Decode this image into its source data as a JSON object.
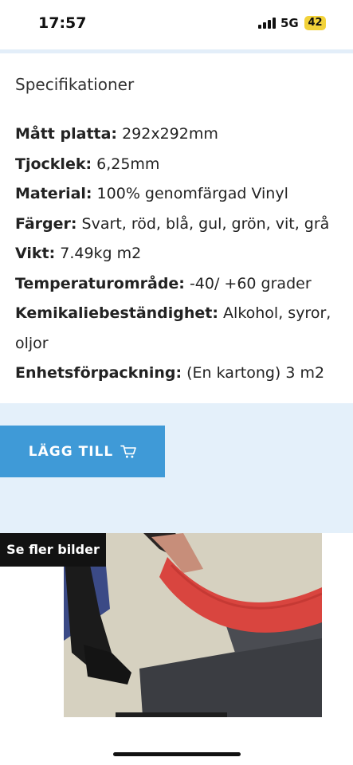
{
  "status_bar": {
    "time": "17:57",
    "network": "5G",
    "battery": "42"
  },
  "specs": {
    "heading": "Specifikationer",
    "rows": [
      {
        "label": "Mått platta:",
        "value": " 292x292mm"
      },
      {
        "label": "Tjocklek:",
        "value": " 6,25mm"
      },
      {
        "label": "Material:",
        "value": " 100% genomfärgad Vinyl"
      },
      {
        "label": "Färger:",
        "value": " Svart, röd, blå, gul, grön, vit, grå"
      },
      {
        "label": "Vikt:",
        "value": " 7.49kg m2"
      },
      {
        "label": "Temperaturområde:",
        "value": " -40/ +60 grader"
      },
      {
        "label": "Kemikaliebeständighet:",
        "value": " Alkohol, syror, oljor"
      },
      {
        "label": "Enhetsförpackning:",
        "value": " (En kartong) 3 m2"
      }
    ]
  },
  "cart": {
    "button_label": "LÄGG TILL",
    "icon": "cart-icon"
  },
  "gallery": {
    "more_images_label": "Se fler bilder"
  },
  "colors": {
    "accent_button": "#3f9ad7",
    "band_bg": "#e4f0fa",
    "label_bg": "#121212"
  }
}
